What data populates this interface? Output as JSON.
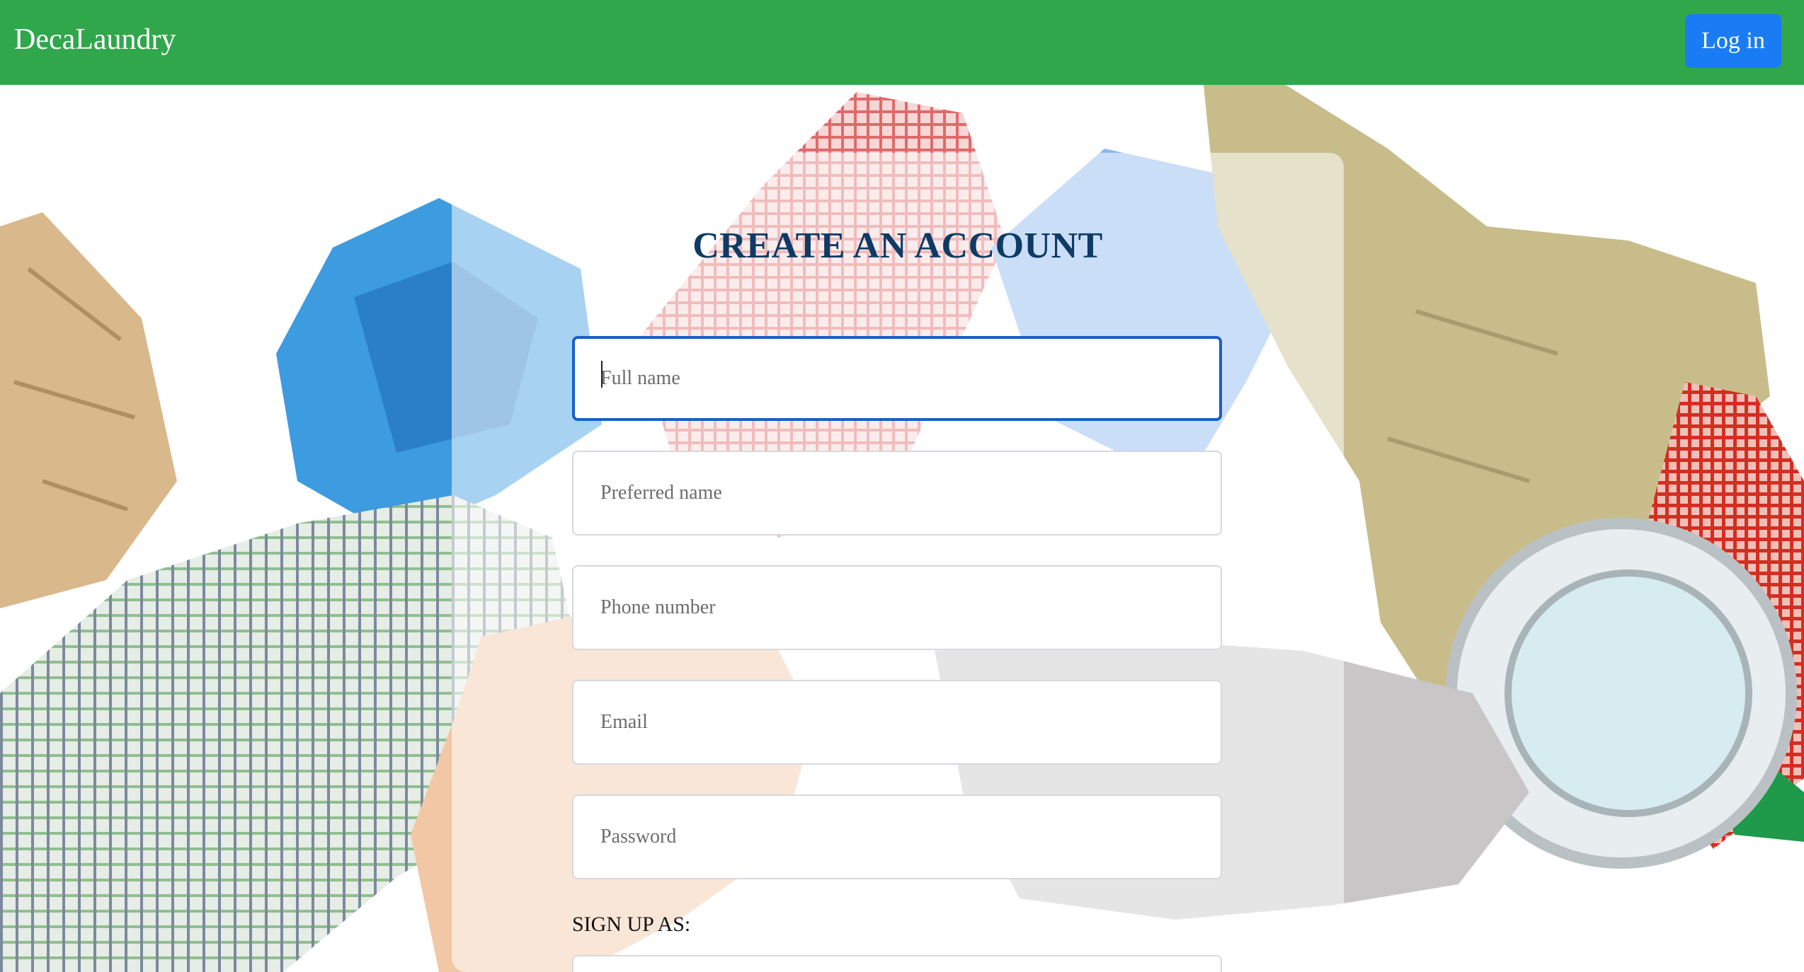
{
  "navbar": {
    "brand": "DecaLaundry",
    "login_label": "Log in",
    "color": "#31a74c",
    "login_color": "#1a7cf5"
  },
  "form": {
    "title": "CREATE AN ACCOUNT",
    "fields": {
      "full_name": "Full name",
      "preferred_name": "Preferred name",
      "phone": "Phone number",
      "email": "Email",
      "password": "Password"
    },
    "signup_as_label": "SIGN UP AS:",
    "title_color": "#0d3b66",
    "focus_color": "#1760c9"
  }
}
